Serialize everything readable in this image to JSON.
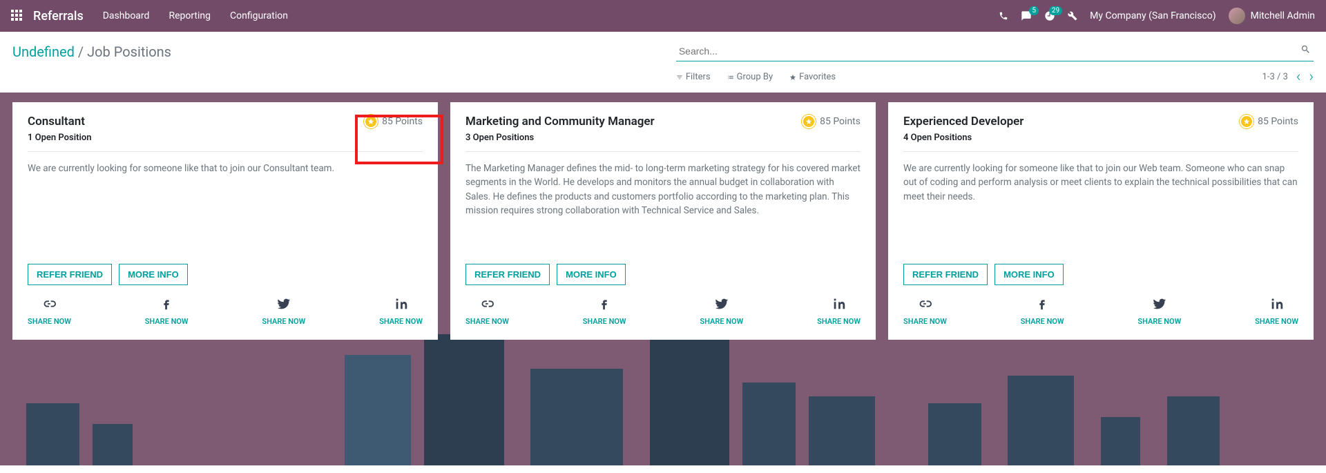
{
  "topbar": {
    "brand": "Referrals",
    "menu": [
      "Dashboard",
      "Reporting",
      "Configuration"
    ],
    "messages_badge": "5",
    "activities_badge": "29",
    "company": "My Company (San Francisco)",
    "user": "Mitchell Admin"
  },
  "breadcrumb": {
    "root": "Undefined",
    "sep": " / ",
    "current": "Job Positions"
  },
  "search": {
    "placeholder": "Search..."
  },
  "filters": {
    "filters": "Filters",
    "groupby": "Group By",
    "favorites": "Favorites"
  },
  "pager": {
    "range": "1-3 / 3"
  },
  "labels": {
    "refer": "REFER FRIEND",
    "more": "MORE INFO",
    "share": "SHARE NOW"
  },
  "cards": [
    {
      "title": "Consultant",
      "open": "1 Open Position",
      "points": "85 Points",
      "desc": "We are currently looking for someone like that to join our Consultant team."
    },
    {
      "title": "Marketing and Community Manager",
      "open": "3 Open Positions",
      "points": "85 Points",
      "desc": "The Marketing Manager defines the mid- to long-term marketing strategy for his covered market segments in the World. He develops and monitors the annual budget in collaboration with Sales. He defines the products and customers portfolio according to the marketing plan. This mission requires strong collaboration with Technical Service and Sales."
    },
    {
      "title": "Experienced Developer",
      "open": "4 Open Positions",
      "points": "85 Points",
      "desc": "We are currently looking for someone like that to join our Web team. Someone who can snap out of coding and perform analysis or meet clients to explain the technical possibilities that can meet their needs."
    }
  ]
}
